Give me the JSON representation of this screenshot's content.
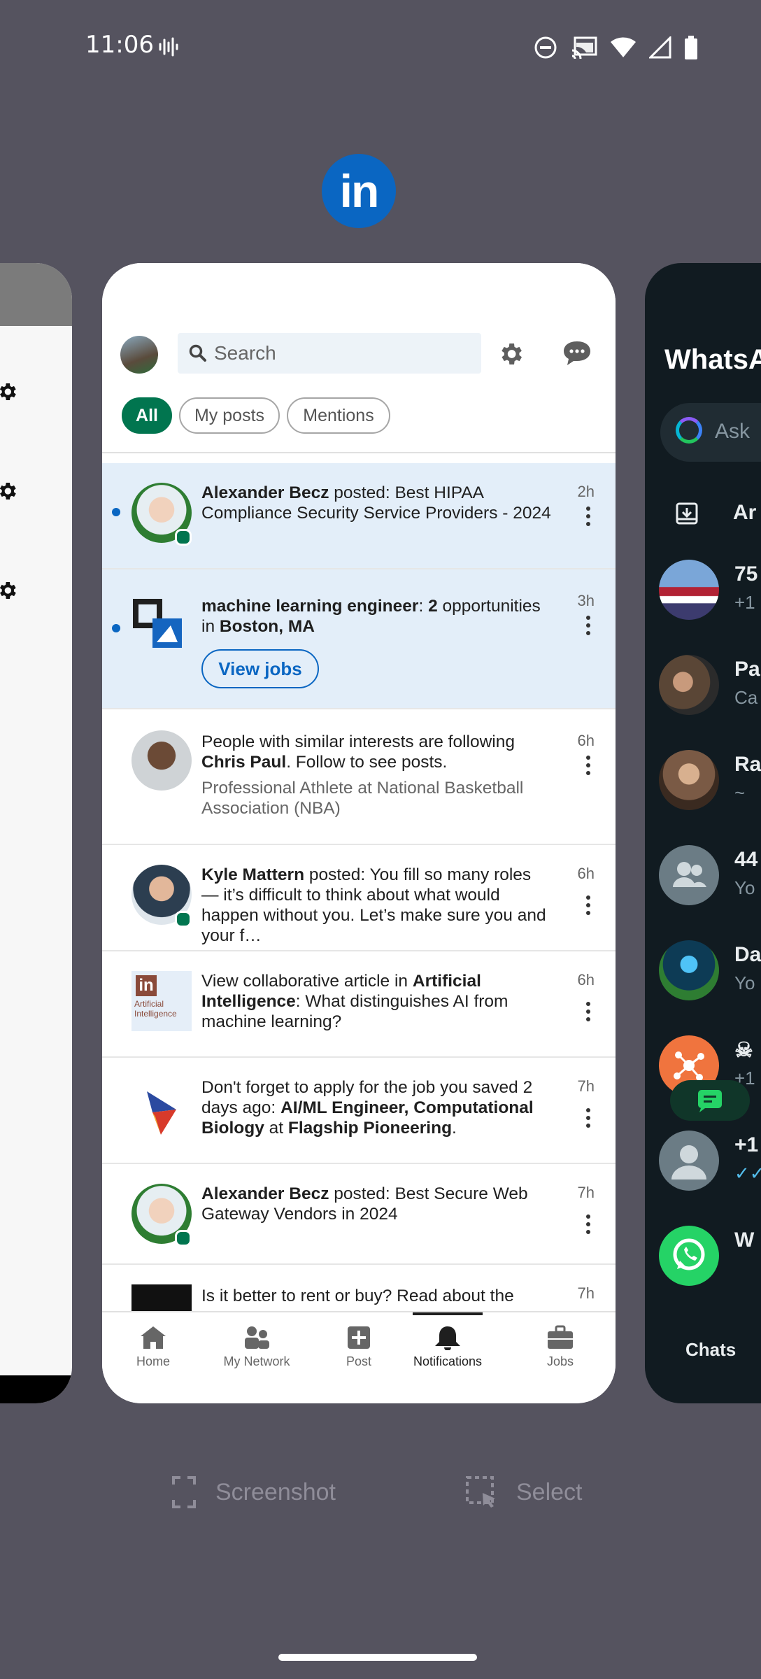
{
  "status_bar": {
    "time": "11:06"
  },
  "app_switcher": {
    "current_app_icon": "linkedin-icon",
    "current_app_icon_text": "in",
    "actions": {
      "screenshot": "Screenshot",
      "select": "Select"
    }
  },
  "linkedin": {
    "search": {
      "placeholder": "Search"
    },
    "filters": [
      "All",
      "My posts",
      "Mentions"
    ],
    "notifications": [
      {
        "author": "Alexander Becz",
        "text_a": " posted: Best HIPAA Compliance Security Service Providers - 2024",
        "time": "2h"
      },
      {
        "title": "machine learning engineer",
        "sep": ": ",
        "count": "2",
        "mid": " opportunities in ",
        "location": "Boston, MA",
        "button": "View jobs",
        "time": "3h"
      },
      {
        "pre": "People with similar interests are following ",
        "person": "Chris Paul",
        "post": ". Follow to see posts.",
        "sub": "Professional Athlete at National Basketball Association (NBA)",
        "time": "6h"
      },
      {
        "author": "Kyle Mattern",
        "text_a": " posted: You fill so many roles — it’s difficult to think about what would happen without you. Let’s make sure you and your f…",
        "time": "6h"
      },
      {
        "pre": "View collaborative article in ",
        "topic": "Artificial Intelligence",
        "post": ": What distinguishes AI from machine learning?",
        "thumb_brand": "in",
        "thumb_line1": "Artificial",
        "thumb_line2": "Intelligence",
        "time": "6h"
      },
      {
        "pre": "Don't forget to apply for the job you saved 2 days ago: ",
        "job": "AI/ML Engineer, Computational Biology",
        "mid": " at ",
        "company": "Flagship Pioneering",
        "end": ".",
        "time": "7h"
      },
      {
        "author": "Alexander Becz",
        "text_a": " posted: Best Secure Web Gateway Vendors in 2024",
        "time": "7h"
      },
      {
        "pre": "Is it better to rent or buy? Read about the",
        "time": "7h"
      }
    ],
    "nav": [
      "Home",
      "My Network",
      "Post",
      "Notifications",
      "Jobs"
    ],
    "active_nav": "Notifications",
    "colors": {
      "brand": "#0a66c2",
      "green": "#01754f",
      "unread_bg": "#e3eef9"
    }
  },
  "whatsapp": {
    "title": "WhatsA",
    "ask_placeholder": "Ask",
    "archived_label": "Ar",
    "chats": [
      {
        "name": "75",
        "sub": "+1"
      },
      {
        "name": "Pa",
        "sub": "Ca"
      },
      {
        "name": "Ra",
        "sub": "~"
      },
      {
        "name": "44",
        "sub": "Yo"
      },
      {
        "name": "Da",
        "sub": "Yo"
      },
      {
        "name": "☠",
        "sub": "+1"
      },
      {
        "name": "+1",
        "sub": "✓✓"
      },
      {
        "name": "W",
        "sub": ""
      }
    ],
    "tab_label": "Chats",
    "colors": {
      "bg": "#111b21",
      "accent": "#25d366"
    }
  }
}
